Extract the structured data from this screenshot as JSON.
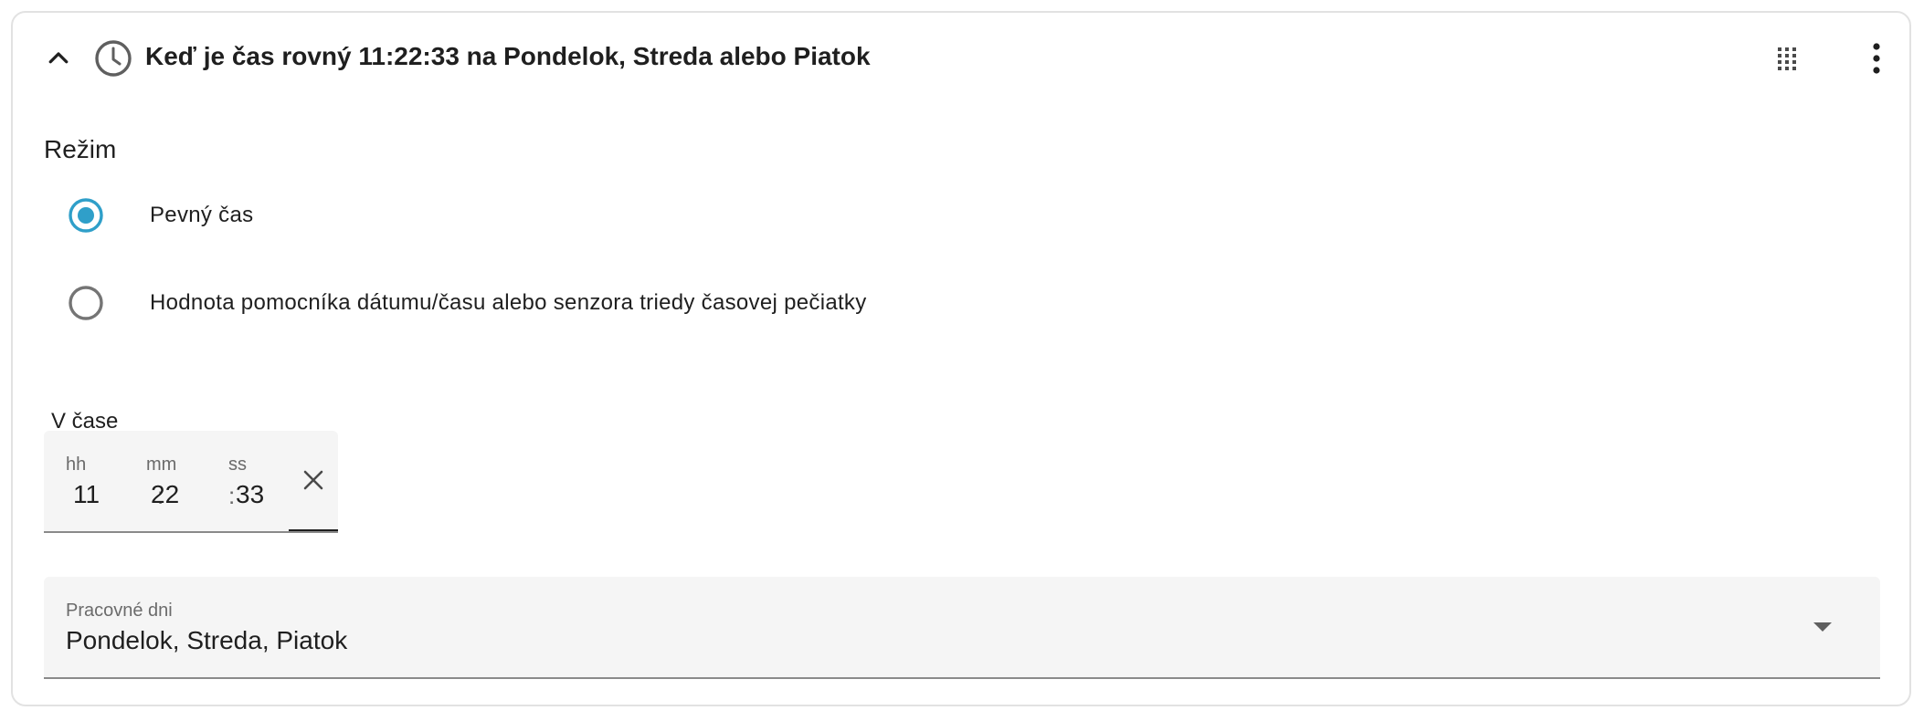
{
  "header": {
    "title": "Keď je čas rovný 11:22:33 na Pondelok, Streda alebo Piatok",
    "collapse_icon": "chevron-up-icon",
    "trigger_icon": "clock-icon",
    "drag_icon": "drag-grid-icon",
    "menu_icon": "dots-vertical-icon"
  },
  "mode": {
    "label": "Režim",
    "options": [
      {
        "label": "Pevný čas",
        "selected": true
      },
      {
        "label": "Hodnota pomocníka dátumu/času alebo senzora triedy časovej pečiatky",
        "selected": false
      }
    ]
  },
  "time": {
    "label": "V čase",
    "hours_label": "hh",
    "hours": "11",
    "minutes_label": "mm",
    "minutes": "22",
    "seconds_label": "ss",
    "seconds": "33",
    "separator": ":"
  },
  "weekdays": {
    "label": "Pracovné dni",
    "value": "Pondelok, Streda, Piatok"
  },
  "colors": {
    "accent": "#2f9fc9",
    "radio_unselected": "#757575",
    "icon": "#5f5f5f",
    "field_bg": "#f5f5f5"
  }
}
